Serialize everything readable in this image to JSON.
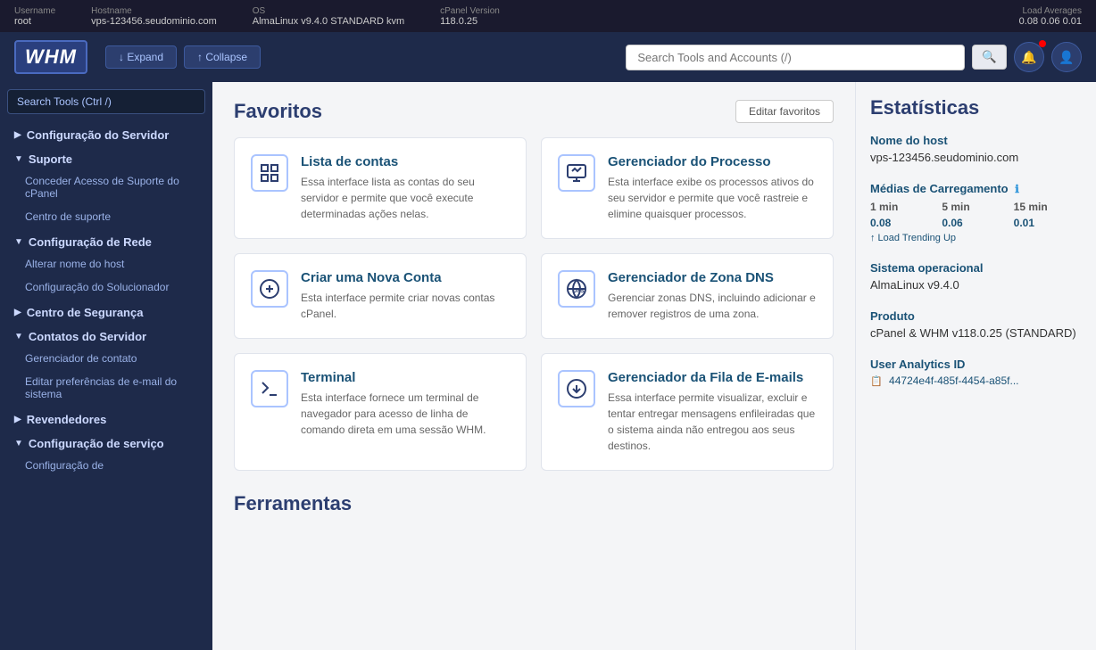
{
  "topbar": {
    "username_label": "Username",
    "username_value": "root",
    "hostname_label": "Hostname",
    "hostname_value": "vps-123456.seudominio.com",
    "os_label": "OS",
    "os_value": "AlmaLinux v9.4.0 STANDARD kvm",
    "cpanel_label": "cPanel Version",
    "cpanel_value": "118.0.25",
    "load_label": "Load Averages",
    "load_values": "0.08  0.06  0.01"
  },
  "header": {
    "logo": "WHM",
    "expand_btn": "↓ Expand",
    "collapse_btn": "↑ Collapse",
    "search_placeholder": "Search Tools and Accounts (/)"
  },
  "sidebar": {
    "search_placeholder": "Search Tools (Ctrl /)",
    "items": [
      {
        "id": "configuracao-servidor",
        "label": "Configuração do Servidor",
        "type": "group",
        "expanded": false
      },
      {
        "id": "suporte",
        "label": "Suporte",
        "type": "group",
        "expanded": true
      },
      {
        "id": "conceder-acesso",
        "label": "Conceder Acesso de Suporte do cPanel",
        "type": "subitem"
      },
      {
        "id": "centro-suporte",
        "label": "Centro de suporte",
        "type": "subitem"
      },
      {
        "id": "config-rede",
        "label": "Configuração de Rede",
        "type": "group",
        "expanded": true
      },
      {
        "id": "alterar-hostname",
        "label": "Alterar nome do host",
        "type": "subitem"
      },
      {
        "id": "config-solucionador",
        "label": "Configuração do Solucionador",
        "type": "subitem"
      },
      {
        "id": "centro-seguranca",
        "label": "Centro de Segurança",
        "type": "group",
        "expanded": false
      },
      {
        "id": "contatos-servidor",
        "label": "Contatos do Servidor",
        "type": "group",
        "expanded": true
      },
      {
        "id": "gerenciador-contato",
        "label": "Gerenciador de contato",
        "type": "subitem"
      },
      {
        "id": "editar-preferencias",
        "label": "Editar preferências de e-mail do sistema",
        "type": "subitem"
      },
      {
        "id": "revendedores",
        "label": "Revendedores",
        "type": "group",
        "expanded": false
      },
      {
        "id": "config-servico",
        "label": "Configuração de serviço",
        "type": "group",
        "expanded": true
      },
      {
        "id": "configuracao-ancora",
        "label": "Configuração de",
        "type": "subitem"
      }
    ]
  },
  "favorites": {
    "title": "Favoritos",
    "edit_btn": "Editar favoritos",
    "cards": [
      {
        "id": "lista-contas",
        "title": "Lista de contas",
        "desc": "Essa interface lista as contas do seu servidor e permite que você execute determinadas ações nelas.",
        "icon": "list"
      },
      {
        "id": "gerenciador-processo",
        "title": "Gerenciador do Processo",
        "desc": "Esta interface exibe os processos ativos do seu servidor e permite que você rastreie e elimine quaisquer processos.",
        "icon": "process"
      },
      {
        "id": "criar-nova-conta",
        "title": "Criar uma Nova Conta",
        "desc": "Esta interface permite criar novas contas cPanel.",
        "icon": "create"
      },
      {
        "id": "gerenciador-zona-dns",
        "title": "Gerenciador de Zona DNS",
        "desc": "Gerenciar zonas DNS, incluindo adicionar e remover registros de uma zona.",
        "icon": "dns"
      },
      {
        "id": "terminal",
        "title": "Terminal",
        "desc": "Esta interface fornece um terminal de navegador para acesso de linha de comando direta em uma sessão WHM.",
        "icon": "terminal"
      },
      {
        "id": "gerenciador-fila-emails",
        "title": "Gerenciador da Fila de E-mails",
        "desc": "Essa interface permite visualizar, excluir e tentar entregar mensagens enfileiradas que o sistema ainda não entregou aos seus destinos.",
        "icon": "email"
      }
    ]
  },
  "ferramentas": {
    "title": "Ferramentas"
  },
  "statistics": {
    "title": "Estatísticas",
    "hostname_label": "Nome do host",
    "hostname_value": "vps-123456.seudominio.com",
    "load_label": "Médias de Carregamento",
    "load_info_icon": "ℹ",
    "load_1min_label": "1 min",
    "load_5min_label": "5 min",
    "load_15min_label": "15 min",
    "load_1min_val": "0.08",
    "load_5min_val": "0.06",
    "load_15min_val": "0.01",
    "load_trend": "↑ Load Trending Up",
    "os_label": "Sistema operacional",
    "os_value": "AlmaLinux v9.4.0",
    "product_label": "Produto",
    "product_value": "cPanel & WHM v118.0.25 (STANDARD)",
    "analytics_label": "User Analytics ID",
    "analytics_value": "44724e4f-485f-4454-a85f..."
  }
}
